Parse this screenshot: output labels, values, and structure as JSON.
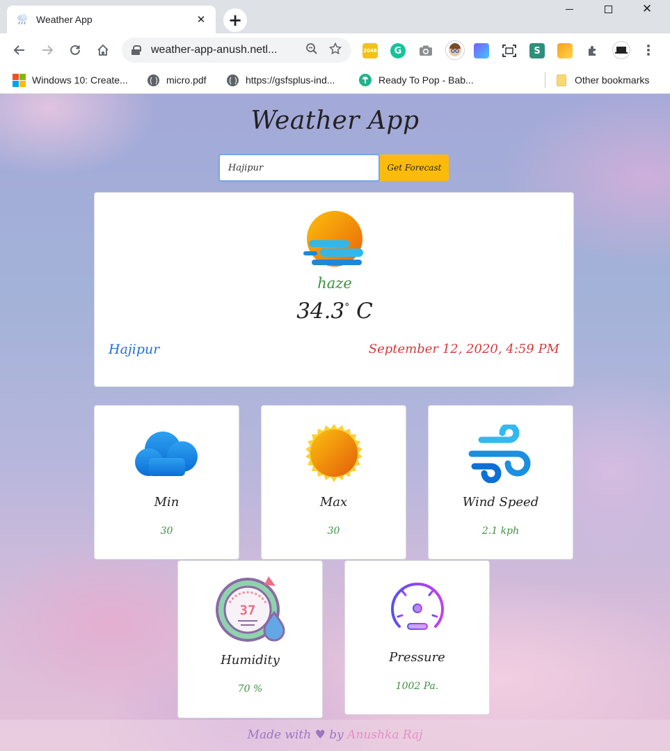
{
  "browser": {
    "tab_title": "Weather App",
    "tab_close": "✕",
    "new_tab": "+",
    "url": "weather-app-anush.netl...",
    "bookmarks": [
      {
        "label": "Windows 10: Create..."
      },
      {
        "label": "micro.pdf"
      },
      {
        "label": "https://gsfsplus-ind..."
      },
      {
        "label": "Ready To Pop - Bab..."
      }
    ],
    "other_bookmarks": "Other bookmarks",
    "extensions": {
      "ext_2048": "2048",
      "grammarly": "G",
      "stylish": "S"
    }
  },
  "app": {
    "title": "Weather App",
    "search": {
      "value": "Hajipur",
      "button_label": "Get Forecast"
    },
    "current": {
      "condition": "haze",
      "temperature": "34.3",
      "degree_symbol": "°",
      "unit": "C",
      "city": "Hajipur",
      "datetime": "September 12, 2020, 4:59 PM"
    },
    "stats": {
      "min": {
        "label": "Min",
        "value": "30"
      },
      "max": {
        "label": "Max",
        "value": "30"
      },
      "wind": {
        "label": "Wind Speed",
        "value": "2.1 kph"
      },
      "humidity": {
        "label": "Humidity",
        "value": "70 %",
        "gauge_text": "37"
      },
      "pressure": {
        "label": "Pressure",
        "value": "1002 Pa."
      }
    },
    "footer": {
      "made_with": "Made with",
      "heart": "♥",
      "by": "by",
      "author": "Anushka Raj"
    }
  },
  "colors": {
    "accent_button": "#fbbb0a",
    "condition_text": "#3d9140",
    "city_text": "#1f6fd0",
    "datetime_text": "#d33b3b"
  }
}
